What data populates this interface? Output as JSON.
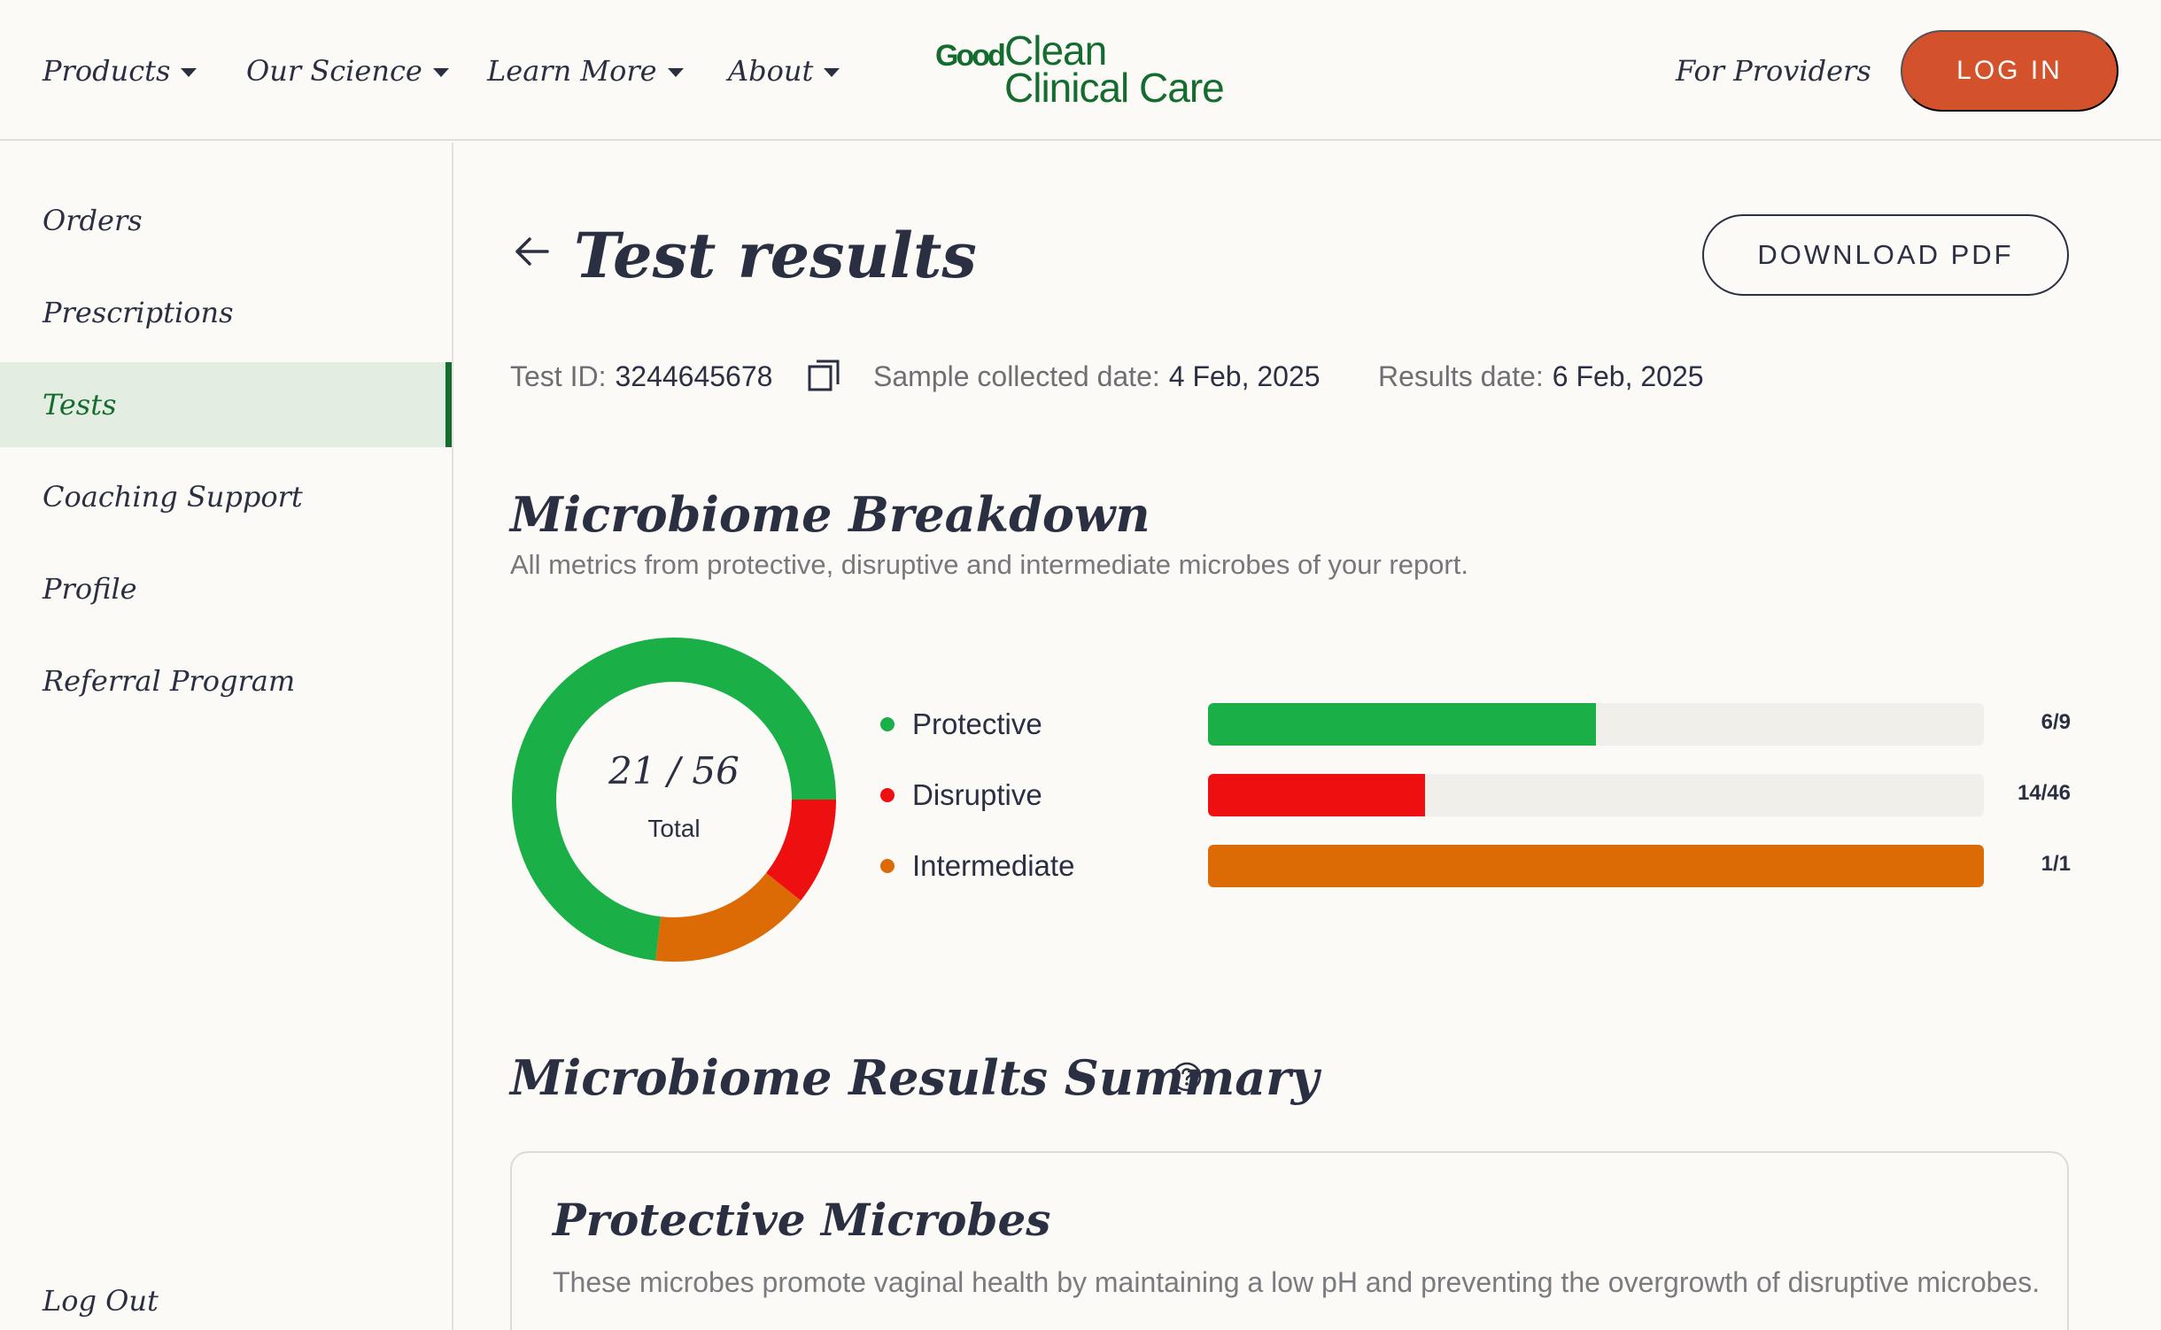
{
  "header": {
    "nav": [
      {
        "label": "Products"
      },
      {
        "label": "Our Science"
      },
      {
        "label": "Learn More"
      },
      {
        "label": "About"
      }
    ],
    "logo": {
      "word1": "Good",
      "line1": "Clean",
      "line2": "Clinical Care"
    },
    "providers_link": "For Providers",
    "login_label": "LOG IN"
  },
  "sidebar": {
    "items": [
      {
        "label": "Orders"
      },
      {
        "label": "Prescriptions"
      },
      {
        "label": "Tests",
        "active": true
      },
      {
        "label": "Coaching Support"
      },
      {
        "label": "Profile"
      },
      {
        "label": "Referral Program"
      }
    ],
    "logout_label": "Log Out"
  },
  "page": {
    "title": "Test results",
    "download_label": "DOWNLOAD PDF",
    "meta": {
      "test_id_label": "Test ID:",
      "test_id": "3244645678",
      "collected_label": "Sample collected date:",
      "collected_date": "4 Feb, 2025",
      "results_label": "Results date:",
      "results_date": "6 Feb, 2025"
    }
  },
  "breakdown": {
    "title": "Microbiome Breakdown",
    "subtitle": "All metrics from protective, disruptive and intermediate microbes of your report.",
    "total_value": "21 / 56",
    "total_label": "Total",
    "donut_fractions": {
      "protective": 0.732,
      "disruptive": 0.107,
      "intermediate": 0.161
    },
    "categories": [
      {
        "label": "Protective",
        "ratio": "6/9",
        "fill_fraction": 0.5,
        "color": "#1aaf47"
      },
      {
        "label": "Disruptive",
        "ratio": "14/46",
        "fill_fraction": 0.28,
        "color": "#ee0f10"
      },
      {
        "label": "Intermediate",
        "ratio": "1/1",
        "fill_fraction": 1.0,
        "color": "#dc6a05"
      }
    ]
  },
  "summary": {
    "title": "Microbiome Results Summary",
    "card_title": "Protective Microbes",
    "card_text": "These microbes promote vaginal health by maintaining a low pH and preventing the overgrowth of disruptive microbes."
  },
  "colors": {
    "brand_green": "#146c2e",
    "login_orange": "#d4522b",
    "active_bg": "#e4ede1",
    "page_bg": "#fbfaf6"
  }
}
